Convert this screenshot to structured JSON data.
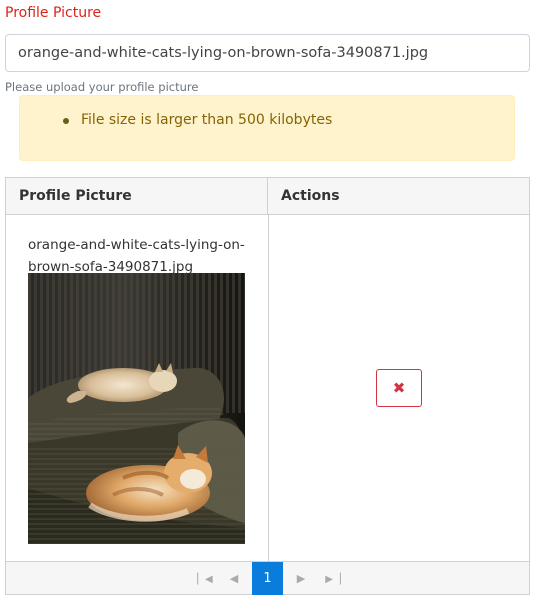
{
  "field": {
    "label": "Profile Picture",
    "file_value": "orange-and-white-cats-lying-on-brown-sofa-3490871.jpg",
    "hint": "Please upload your profile picture"
  },
  "alert": {
    "messages": [
      "File size is larger than 500 kilobytes"
    ]
  },
  "table": {
    "columns": [
      "Profile Picture",
      "Actions"
    ],
    "rows": [
      {
        "filename_line1": "orange-and-white-cats-lying-on-",
        "filename_line2": "brown-sofa-3490871.jpg",
        "delete_icon": "close-icon"
      }
    ]
  },
  "pager": {
    "current_page": "1",
    "first_icon": "page-first-icon",
    "prev_icon": "page-prev-icon",
    "next_icon": "page-next-icon",
    "last_icon": "page-last-icon"
  },
  "colors": {
    "label": "#d9241d",
    "alert_bg": "#fff3cd",
    "alert_text": "#856404",
    "delete": "#d13545",
    "pager_active": "#0a7ddc"
  }
}
